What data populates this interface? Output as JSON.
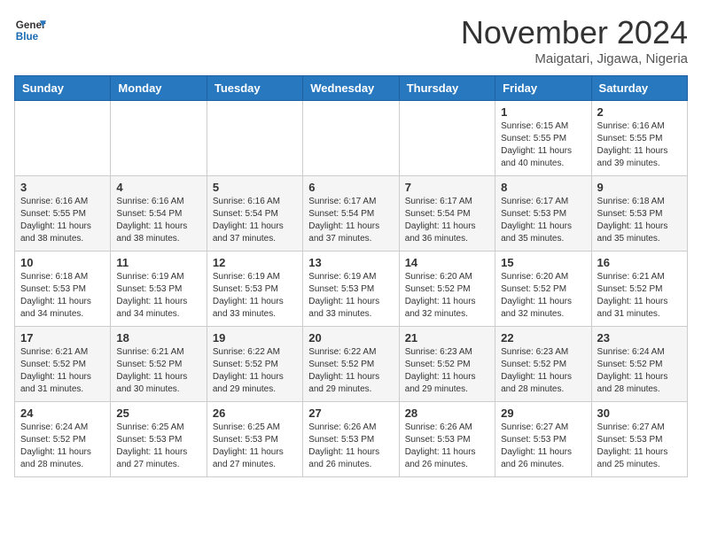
{
  "logo": {
    "text_general": "General",
    "text_blue": "Blue"
  },
  "title": "November 2024",
  "location": "Maigatari, Jigawa, Nigeria",
  "days_of_week": [
    "Sunday",
    "Monday",
    "Tuesday",
    "Wednesday",
    "Thursday",
    "Friday",
    "Saturday"
  ],
  "weeks": [
    [
      {
        "day": "",
        "info": ""
      },
      {
        "day": "",
        "info": ""
      },
      {
        "day": "",
        "info": ""
      },
      {
        "day": "",
        "info": ""
      },
      {
        "day": "",
        "info": ""
      },
      {
        "day": "1",
        "info": "Sunrise: 6:15 AM\nSunset: 5:55 PM\nDaylight: 11 hours\nand 40 minutes."
      },
      {
        "day": "2",
        "info": "Sunrise: 6:16 AM\nSunset: 5:55 PM\nDaylight: 11 hours\nand 39 minutes."
      }
    ],
    [
      {
        "day": "3",
        "info": "Sunrise: 6:16 AM\nSunset: 5:55 PM\nDaylight: 11 hours\nand 38 minutes."
      },
      {
        "day": "4",
        "info": "Sunrise: 6:16 AM\nSunset: 5:54 PM\nDaylight: 11 hours\nand 38 minutes."
      },
      {
        "day": "5",
        "info": "Sunrise: 6:16 AM\nSunset: 5:54 PM\nDaylight: 11 hours\nand 37 minutes."
      },
      {
        "day": "6",
        "info": "Sunrise: 6:17 AM\nSunset: 5:54 PM\nDaylight: 11 hours\nand 37 minutes."
      },
      {
        "day": "7",
        "info": "Sunrise: 6:17 AM\nSunset: 5:54 PM\nDaylight: 11 hours\nand 36 minutes."
      },
      {
        "day": "8",
        "info": "Sunrise: 6:17 AM\nSunset: 5:53 PM\nDaylight: 11 hours\nand 35 minutes."
      },
      {
        "day": "9",
        "info": "Sunrise: 6:18 AM\nSunset: 5:53 PM\nDaylight: 11 hours\nand 35 minutes."
      }
    ],
    [
      {
        "day": "10",
        "info": "Sunrise: 6:18 AM\nSunset: 5:53 PM\nDaylight: 11 hours\nand 34 minutes."
      },
      {
        "day": "11",
        "info": "Sunrise: 6:19 AM\nSunset: 5:53 PM\nDaylight: 11 hours\nand 34 minutes."
      },
      {
        "day": "12",
        "info": "Sunrise: 6:19 AM\nSunset: 5:53 PM\nDaylight: 11 hours\nand 33 minutes."
      },
      {
        "day": "13",
        "info": "Sunrise: 6:19 AM\nSunset: 5:53 PM\nDaylight: 11 hours\nand 33 minutes."
      },
      {
        "day": "14",
        "info": "Sunrise: 6:20 AM\nSunset: 5:52 PM\nDaylight: 11 hours\nand 32 minutes."
      },
      {
        "day": "15",
        "info": "Sunrise: 6:20 AM\nSunset: 5:52 PM\nDaylight: 11 hours\nand 32 minutes."
      },
      {
        "day": "16",
        "info": "Sunrise: 6:21 AM\nSunset: 5:52 PM\nDaylight: 11 hours\nand 31 minutes."
      }
    ],
    [
      {
        "day": "17",
        "info": "Sunrise: 6:21 AM\nSunset: 5:52 PM\nDaylight: 11 hours\nand 31 minutes."
      },
      {
        "day": "18",
        "info": "Sunrise: 6:21 AM\nSunset: 5:52 PM\nDaylight: 11 hours\nand 30 minutes."
      },
      {
        "day": "19",
        "info": "Sunrise: 6:22 AM\nSunset: 5:52 PM\nDaylight: 11 hours\nand 29 minutes."
      },
      {
        "day": "20",
        "info": "Sunrise: 6:22 AM\nSunset: 5:52 PM\nDaylight: 11 hours\nand 29 minutes."
      },
      {
        "day": "21",
        "info": "Sunrise: 6:23 AM\nSunset: 5:52 PM\nDaylight: 11 hours\nand 29 minutes."
      },
      {
        "day": "22",
        "info": "Sunrise: 6:23 AM\nSunset: 5:52 PM\nDaylight: 11 hours\nand 28 minutes."
      },
      {
        "day": "23",
        "info": "Sunrise: 6:24 AM\nSunset: 5:52 PM\nDaylight: 11 hours\nand 28 minutes."
      }
    ],
    [
      {
        "day": "24",
        "info": "Sunrise: 6:24 AM\nSunset: 5:52 PM\nDaylight: 11 hours\nand 28 minutes."
      },
      {
        "day": "25",
        "info": "Sunrise: 6:25 AM\nSunset: 5:53 PM\nDaylight: 11 hours\nand 27 minutes."
      },
      {
        "day": "26",
        "info": "Sunrise: 6:25 AM\nSunset: 5:53 PM\nDaylight: 11 hours\nand 27 minutes."
      },
      {
        "day": "27",
        "info": "Sunrise: 6:26 AM\nSunset: 5:53 PM\nDaylight: 11 hours\nand 26 minutes."
      },
      {
        "day": "28",
        "info": "Sunrise: 6:26 AM\nSunset: 5:53 PM\nDaylight: 11 hours\nand 26 minutes."
      },
      {
        "day": "29",
        "info": "Sunrise: 6:27 AM\nSunset: 5:53 PM\nDaylight: 11 hours\nand 26 minutes."
      },
      {
        "day": "30",
        "info": "Sunrise: 6:27 AM\nSunset: 5:53 PM\nDaylight: 11 hours\nand 25 minutes."
      }
    ]
  ]
}
